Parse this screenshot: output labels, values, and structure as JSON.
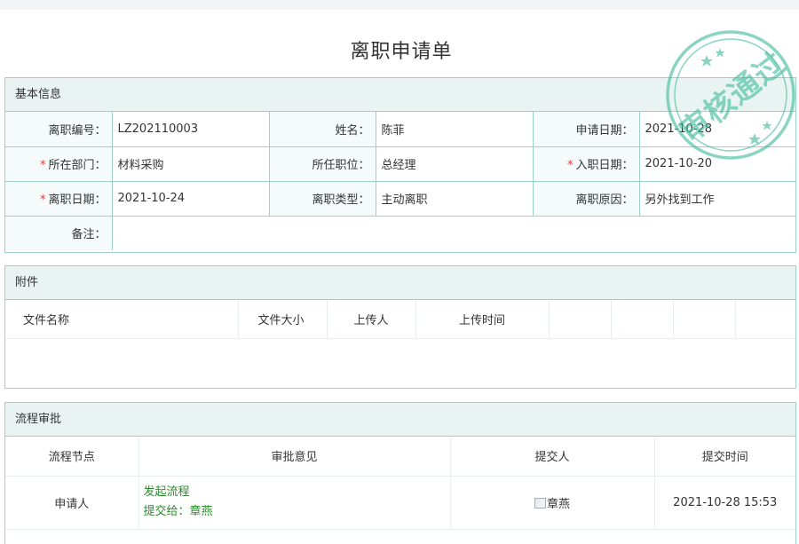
{
  "form_title": "离职申请单",
  "stamp": {
    "text": "审核通过",
    "color": "#3dba9a"
  },
  "basic": {
    "header": "基本信息",
    "labels": {
      "resign_no": "离职编号：",
      "name": "姓名：",
      "apply_date": "申请日期：",
      "dept": "所在部门：",
      "position": "所任职位：",
      "join_date": "入职日期：",
      "resign_date": "离职日期：",
      "resign_type": "离职类型：",
      "reason": "离职原因：",
      "remark": "备注："
    },
    "values": {
      "resign_no": "LZ202110003",
      "name": "陈菲",
      "apply_date": "2021-10-28",
      "dept": "材料采购",
      "position": "总经理",
      "join_date": "2021-10-20",
      "resign_date": "2021-10-24",
      "resign_type": "主动离职",
      "reason": "另外找到工作",
      "remark": ""
    },
    "required_mark": "*"
  },
  "attachments": {
    "header": "附件",
    "columns": [
      "文件名称",
      "文件大小",
      "上传人",
      "上传时间"
    ]
  },
  "approval": {
    "header": "流程审批",
    "columns": [
      "流程节点",
      "审批意见",
      "提交人",
      "提交时间"
    ],
    "rows": [
      {
        "node": "申请人",
        "opinion_line1": "发起流程",
        "opinion_line2": "提交给：章燕",
        "submitter": "章燕",
        "time": "2021-10-28 15:53"
      }
    ]
  }
}
